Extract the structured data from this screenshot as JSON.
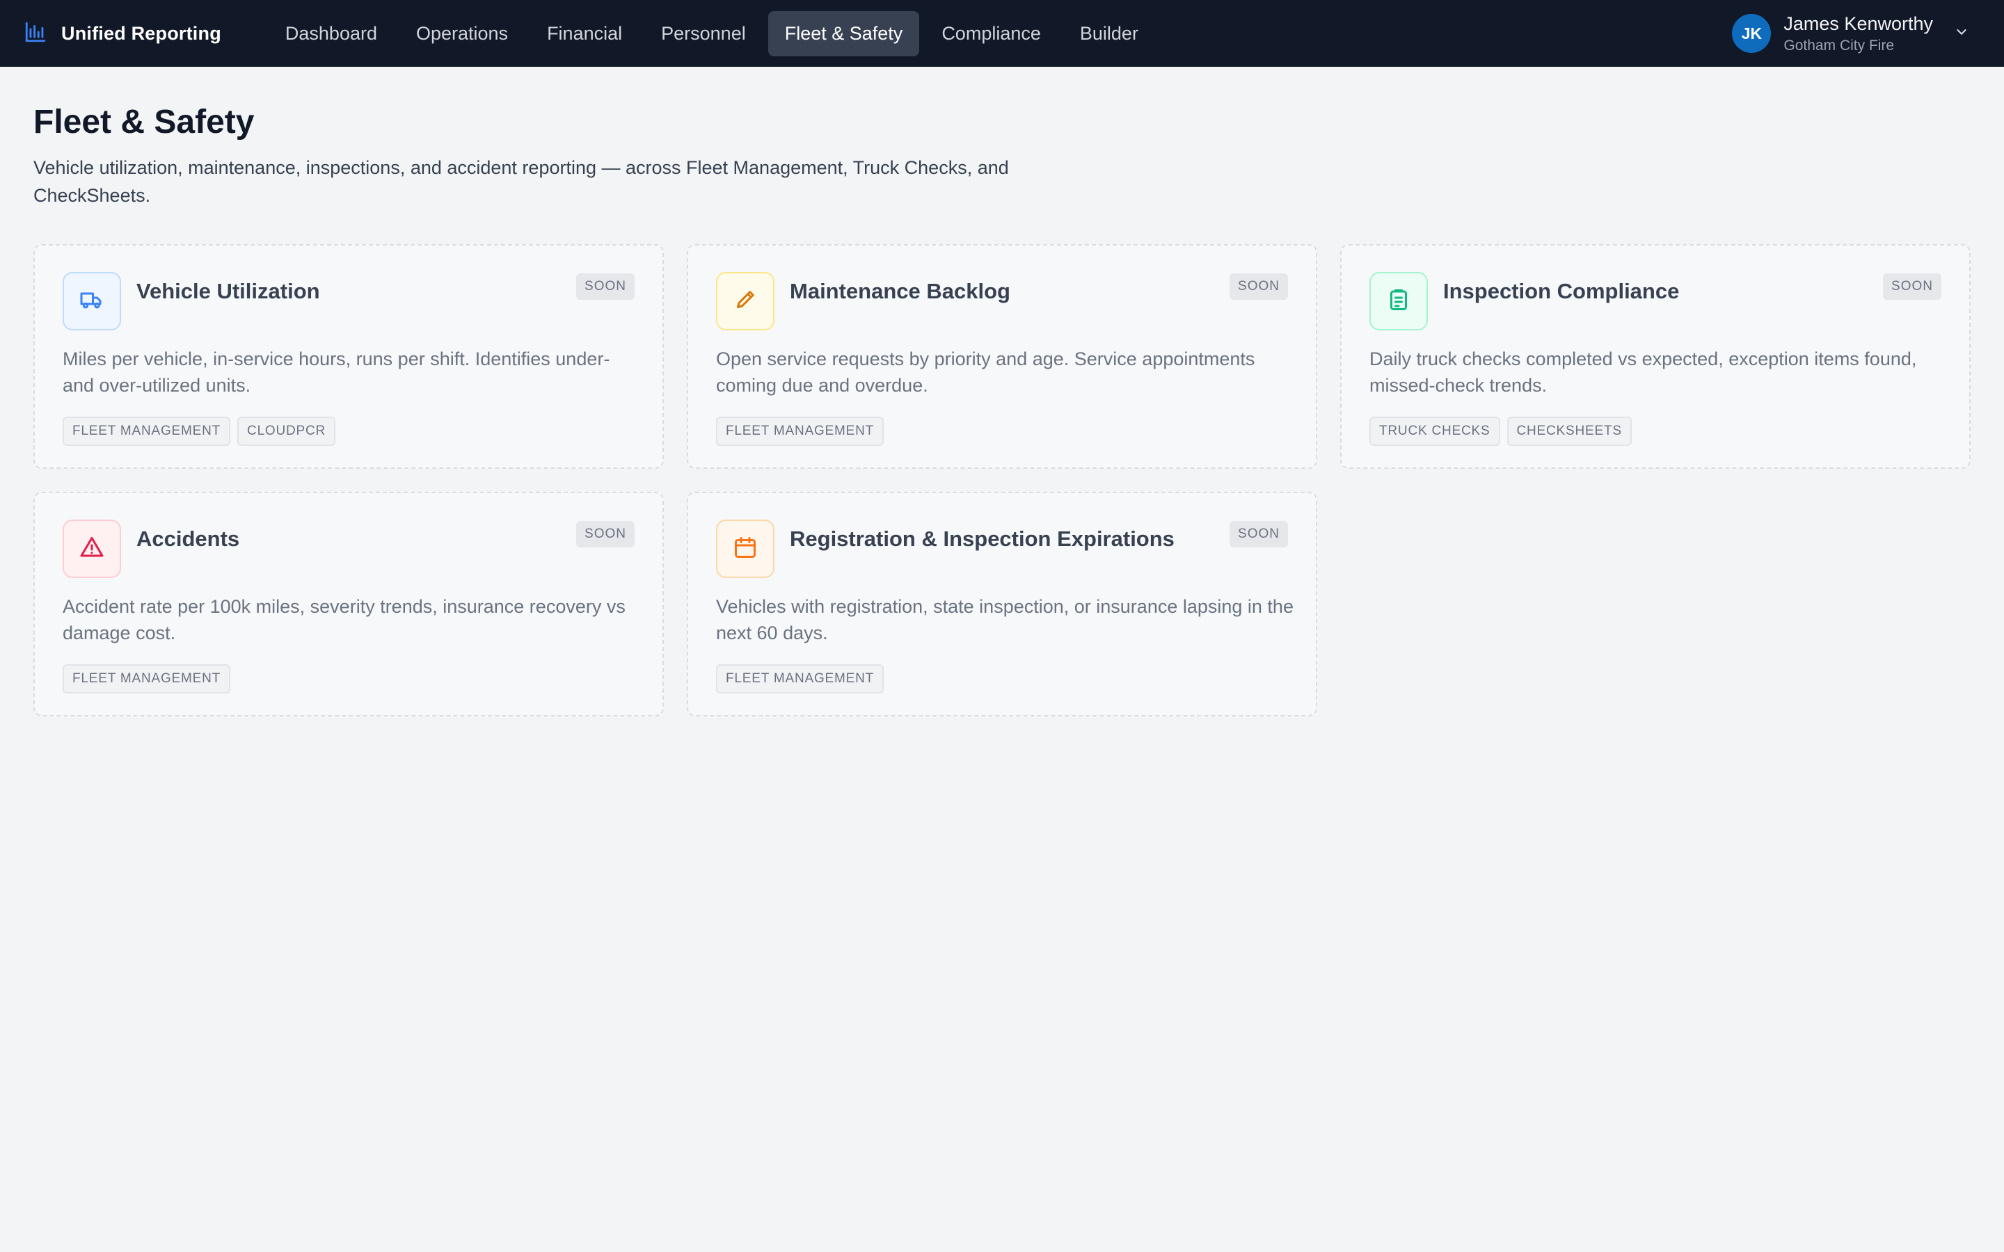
{
  "app": {
    "title": "Unified Reporting",
    "logo_icon": "bar-chart-icon"
  },
  "nav": {
    "items": [
      {
        "label": "Dashboard",
        "active": false
      },
      {
        "label": "Operations",
        "active": false
      },
      {
        "label": "Financial",
        "active": false
      },
      {
        "label": "Personnel",
        "active": false
      },
      {
        "label": "Fleet & Safety",
        "active": true
      },
      {
        "label": "Compliance",
        "active": false
      },
      {
        "label": "Builder",
        "active": false
      }
    ]
  },
  "user": {
    "initials": "JK",
    "name": "James Kenworthy",
    "org": "Gotham City Fire",
    "avatar_color": "#0f6cbd"
  },
  "page": {
    "title": "Fleet & Safety",
    "description": "Vehicle utilization, maintenance, inspections, and accident reporting — across Fleet Management, Truck Checks, and CheckSheets."
  },
  "cards": [
    {
      "title": "Vehicle Utilization",
      "badge": "SOON",
      "icon": "truck-icon",
      "accent": "#3b82f6",
      "description": "Miles per vehicle, in-service hours, runs per shift. Identifies under- and over-utilized units.",
      "tags": [
        "FLEET MANAGEMENT",
        "CLOUDPCR"
      ]
    },
    {
      "title": "Maintenance Backlog",
      "badge": "SOON",
      "icon": "pencil-icon",
      "accent": "#d97706",
      "description": "Open service requests by priority and age. Service appointments coming due and overdue.",
      "tags": [
        "FLEET MANAGEMENT"
      ]
    },
    {
      "title": "Inspection Compliance",
      "badge": "SOON",
      "icon": "clipboard-icon",
      "accent": "#10b981",
      "description": "Daily truck checks completed vs expected, exception items found, missed-check trends.",
      "tags": [
        "TRUCK CHECKS",
        "CHECKSHEETS"
      ]
    },
    {
      "title": "Accidents",
      "badge": "SOON",
      "icon": "warning-triangle-icon",
      "accent": "#e11d48",
      "description": "Accident rate per 100k miles, severity trends, insurance recovery vs damage cost.",
      "tags": [
        "FLEET MANAGEMENT"
      ]
    },
    {
      "title": "Registration & Inspection Expirations",
      "badge": "SOON",
      "icon": "calendar-icon",
      "accent": "#f97316",
      "description": "Vehicles with registration, state inspection, or insurance lapsing in the next 60 days.",
      "tags": [
        "FLEET MANAGEMENT"
      ]
    }
  ]
}
